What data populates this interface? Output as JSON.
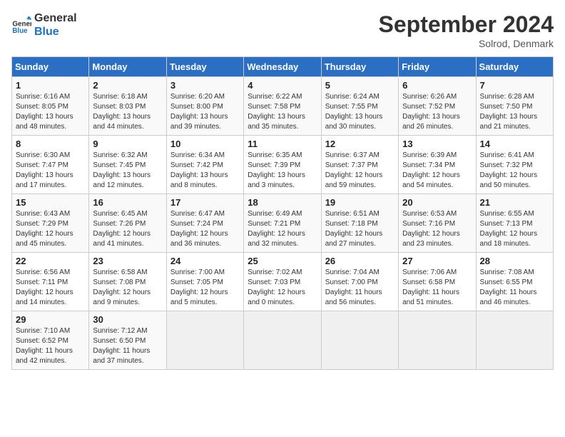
{
  "header": {
    "logo_line1": "General",
    "logo_line2": "Blue",
    "month": "September 2024",
    "location": "Solrod, Denmark"
  },
  "weekdays": [
    "Sunday",
    "Monday",
    "Tuesday",
    "Wednesday",
    "Thursday",
    "Friday",
    "Saturday"
  ],
  "weeks": [
    [
      {
        "day": "1",
        "info": "Sunrise: 6:16 AM\nSunset: 8:05 PM\nDaylight: 13 hours and 48 minutes."
      },
      {
        "day": "2",
        "info": "Sunrise: 6:18 AM\nSunset: 8:03 PM\nDaylight: 13 hours and 44 minutes."
      },
      {
        "day": "3",
        "info": "Sunrise: 6:20 AM\nSunset: 8:00 PM\nDaylight: 13 hours and 39 minutes."
      },
      {
        "day": "4",
        "info": "Sunrise: 6:22 AM\nSunset: 7:58 PM\nDaylight: 13 hours and 35 minutes."
      },
      {
        "day": "5",
        "info": "Sunrise: 6:24 AM\nSunset: 7:55 PM\nDaylight: 13 hours and 30 minutes."
      },
      {
        "day": "6",
        "info": "Sunrise: 6:26 AM\nSunset: 7:52 PM\nDaylight: 13 hours and 26 minutes."
      },
      {
        "day": "7",
        "info": "Sunrise: 6:28 AM\nSunset: 7:50 PM\nDaylight: 13 hours and 21 minutes."
      }
    ],
    [
      {
        "day": "8",
        "info": "Sunrise: 6:30 AM\nSunset: 7:47 PM\nDaylight: 13 hours and 17 minutes."
      },
      {
        "day": "9",
        "info": "Sunrise: 6:32 AM\nSunset: 7:45 PM\nDaylight: 13 hours and 12 minutes."
      },
      {
        "day": "10",
        "info": "Sunrise: 6:34 AM\nSunset: 7:42 PM\nDaylight: 13 hours and 8 minutes."
      },
      {
        "day": "11",
        "info": "Sunrise: 6:35 AM\nSunset: 7:39 PM\nDaylight: 13 hours and 3 minutes."
      },
      {
        "day": "12",
        "info": "Sunrise: 6:37 AM\nSunset: 7:37 PM\nDaylight: 12 hours and 59 minutes."
      },
      {
        "day": "13",
        "info": "Sunrise: 6:39 AM\nSunset: 7:34 PM\nDaylight: 12 hours and 54 minutes."
      },
      {
        "day": "14",
        "info": "Sunrise: 6:41 AM\nSunset: 7:32 PM\nDaylight: 12 hours and 50 minutes."
      }
    ],
    [
      {
        "day": "15",
        "info": "Sunrise: 6:43 AM\nSunset: 7:29 PM\nDaylight: 12 hours and 45 minutes."
      },
      {
        "day": "16",
        "info": "Sunrise: 6:45 AM\nSunset: 7:26 PM\nDaylight: 12 hours and 41 minutes."
      },
      {
        "day": "17",
        "info": "Sunrise: 6:47 AM\nSunset: 7:24 PM\nDaylight: 12 hours and 36 minutes."
      },
      {
        "day": "18",
        "info": "Sunrise: 6:49 AM\nSunset: 7:21 PM\nDaylight: 12 hours and 32 minutes."
      },
      {
        "day": "19",
        "info": "Sunrise: 6:51 AM\nSunset: 7:18 PM\nDaylight: 12 hours and 27 minutes."
      },
      {
        "day": "20",
        "info": "Sunrise: 6:53 AM\nSunset: 7:16 PM\nDaylight: 12 hours and 23 minutes."
      },
      {
        "day": "21",
        "info": "Sunrise: 6:55 AM\nSunset: 7:13 PM\nDaylight: 12 hours and 18 minutes."
      }
    ],
    [
      {
        "day": "22",
        "info": "Sunrise: 6:56 AM\nSunset: 7:11 PM\nDaylight: 12 hours and 14 minutes."
      },
      {
        "day": "23",
        "info": "Sunrise: 6:58 AM\nSunset: 7:08 PM\nDaylight: 12 hours and 9 minutes."
      },
      {
        "day": "24",
        "info": "Sunrise: 7:00 AM\nSunset: 7:05 PM\nDaylight: 12 hours and 5 minutes."
      },
      {
        "day": "25",
        "info": "Sunrise: 7:02 AM\nSunset: 7:03 PM\nDaylight: 12 hours and 0 minutes."
      },
      {
        "day": "26",
        "info": "Sunrise: 7:04 AM\nSunset: 7:00 PM\nDaylight: 11 hours and 56 minutes."
      },
      {
        "day": "27",
        "info": "Sunrise: 7:06 AM\nSunset: 6:58 PM\nDaylight: 11 hours and 51 minutes."
      },
      {
        "day": "28",
        "info": "Sunrise: 7:08 AM\nSunset: 6:55 PM\nDaylight: 11 hours and 46 minutes."
      }
    ],
    [
      {
        "day": "29",
        "info": "Sunrise: 7:10 AM\nSunset: 6:52 PM\nDaylight: 11 hours and 42 minutes."
      },
      {
        "day": "30",
        "info": "Sunrise: 7:12 AM\nSunset: 6:50 PM\nDaylight: 11 hours and 37 minutes."
      },
      {
        "day": "",
        "info": ""
      },
      {
        "day": "",
        "info": ""
      },
      {
        "day": "",
        "info": ""
      },
      {
        "day": "",
        "info": ""
      },
      {
        "day": "",
        "info": ""
      }
    ]
  ]
}
